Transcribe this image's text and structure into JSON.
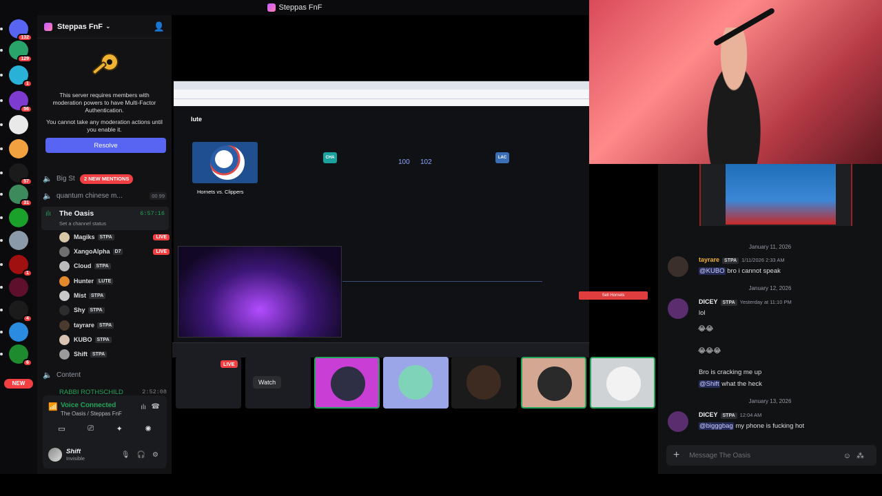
{
  "window_title": "Steppas FnF",
  "server": {
    "name": "Steppas FnF"
  },
  "rail": [
    {
      "icon": "discord-icon",
      "badge": "132",
      "color": "#5865f2"
    },
    {
      "icon": "server-icon",
      "badge": "129",
      "color": "#2aa36b"
    },
    {
      "icon": "server-icon",
      "badge": "1",
      "color": "#2ab1d8"
    },
    {
      "icon": "server-icon",
      "badge": "56",
      "color": "#7e3bd0"
    },
    {
      "icon": "server-icon",
      "badge": "",
      "color": "#e9e9e9"
    },
    {
      "icon": "horizon-icon",
      "badge": "",
      "color": "#f2a141"
    },
    {
      "icon": "server-icon",
      "badge": "57",
      "color": "#1b1b1b"
    },
    {
      "icon": "server-icon",
      "badge": "31",
      "color": "#3d8b5c"
    },
    {
      "icon": "m-icon",
      "badge": "",
      "color": "#1aa12c"
    },
    {
      "icon": "server-icon",
      "badge": "",
      "color": "#8a9aa8"
    },
    {
      "icon": "server-icon",
      "badge": "1",
      "color": "#a01010"
    },
    {
      "icon": "server-icon",
      "badge": "",
      "color": "#5d0f2c"
    },
    {
      "icon": "server-icon",
      "badge": "4",
      "color": "#1b1b1b"
    },
    {
      "icon": "atom-icon",
      "badge": "",
      "color": "#2b8be0"
    },
    {
      "icon": "zzz-icon",
      "badge": "6",
      "color": "#1d8b2e"
    }
  ],
  "new_pill": "NEW",
  "mfa": {
    "line1": "This server requires members with moderation powers to have Multi-Factor Authentication.",
    "line2": "You cannot take any moderation actions until you enable it.",
    "resolve": "Resolve"
  },
  "channels": {
    "big": "Big St",
    "mentions": "2 NEW MENTIONS",
    "quantum": "quantum chinese m...",
    "quantum_num": "00 99",
    "oasis": "The Oasis",
    "oasis_timer": "6:57:16",
    "oasis_status": "Set a channel status",
    "content": "Content",
    "rabbi": "RABBI ROTHSCHILD",
    "rabbi_time": "2:52:08"
  },
  "voice_users": [
    {
      "name": "Magiks",
      "tag": "STPA",
      "live": "LIVE",
      "color": "#d7c9a8"
    },
    {
      "name": "XangoAlpha",
      "tag": "D7",
      "live": "LIVE",
      "color": "#6f6f6f"
    },
    {
      "name": "Cloud",
      "tag": "STPA",
      "live": "",
      "color": "#bbbbbb"
    },
    {
      "name": "Hunter",
      "tag": "LUTE",
      "live": "",
      "color": "#e28a2c"
    },
    {
      "name": "Mist",
      "tag": "STPA",
      "live": "",
      "color": "#c7c7c7"
    },
    {
      "name": "Shy",
      "tag": "STPA",
      "live": "",
      "color": "#2d2d2d"
    },
    {
      "name": "tayrare",
      "tag": "STPA",
      "live": "",
      "color": "#4a3b2e"
    },
    {
      "name": "KUBO",
      "tag": "STPA",
      "live": "",
      "color": "#d8c2b0"
    },
    {
      "name": "Shift",
      "tag": "STPA",
      "live": "",
      "color": "#9a9a9a"
    }
  ],
  "voice": {
    "title": "Voice Connected",
    "sub": "The Oasis / Steppas FnF"
  },
  "me": {
    "name": "Shift",
    "status": "Invisible"
  },
  "stream": {
    "brand": "lute",
    "matchup": "Hornets vs. Clippers",
    "team_a": "CHA",
    "team_b": "LAC",
    "odds_a": "100",
    "odds_b": "102",
    "sell": "Sell Hornets"
  },
  "thumbs": {
    "live": "LIVE",
    "watch": "Watch"
  },
  "chat": {
    "date1": "January 11, 2026",
    "m1_author": "tayrare",
    "m1_tag": "STPA",
    "m1_time": "1/11/2026 2:33 AM",
    "m1_mention": "@KUBO",
    "m1_text": " bro i cannot speak",
    "date2": "January 12, 2026",
    "m2_author": "DICEY",
    "m2_tag": "STPA",
    "m2_time": "Yesterday at 11:10 PM",
    "m2_text": "lol",
    "m2_emoji1": "😂😂",
    "m2_emoji2": "😂😂😂",
    "m2_text2": "Bro is cracking me up",
    "m2_mention": "@Shift",
    "m2_text3": " what the heck",
    "date3": "January 13, 2026",
    "m3_author": "DICEY",
    "m3_tag": "STPA",
    "m3_time": "12:04 AM",
    "m3_mention": "@bigggbag",
    "m3_text": " my phone is fucking hot",
    "placeholder": "Message The Oasis"
  }
}
